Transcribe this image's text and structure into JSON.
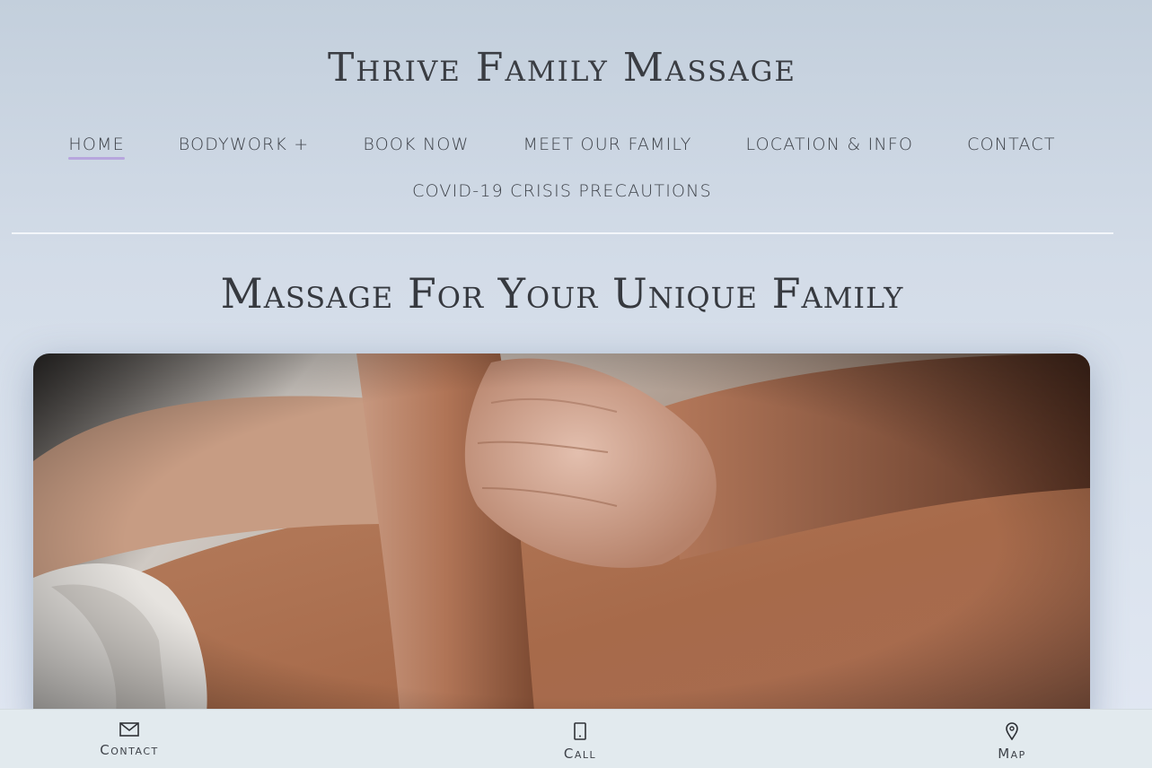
{
  "site": {
    "title": "Thrive Family Massage"
  },
  "nav": {
    "row1": [
      "HOME",
      "BODYWORK +",
      "BOOK NOW",
      "MEET OUR FAMILY",
      "LOCATION & INFO",
      "CONTACT"
    ],
    "row2": [
      "COVID-19 CRISIS PRECAUTIONS"
    ],
    "active": "HOME"
  },
  "main": {
    "headline": "Massage For Your Unique Family"
  },
  "bottom_bar": {
    "contact": {
      "label": "Contact",
      "icon": "envelope-icon"
    },
    "call": {
      "label": "Call",
      "icon": "phone-icon"
    },
    "map": {
      "label": "Map",
      "icon": "map-pin-icon"
    }
  },
  "colors": {
    "accent_underline": "#b7a6dd",
    "bar_bg": "#e2eaee"
  }
}
